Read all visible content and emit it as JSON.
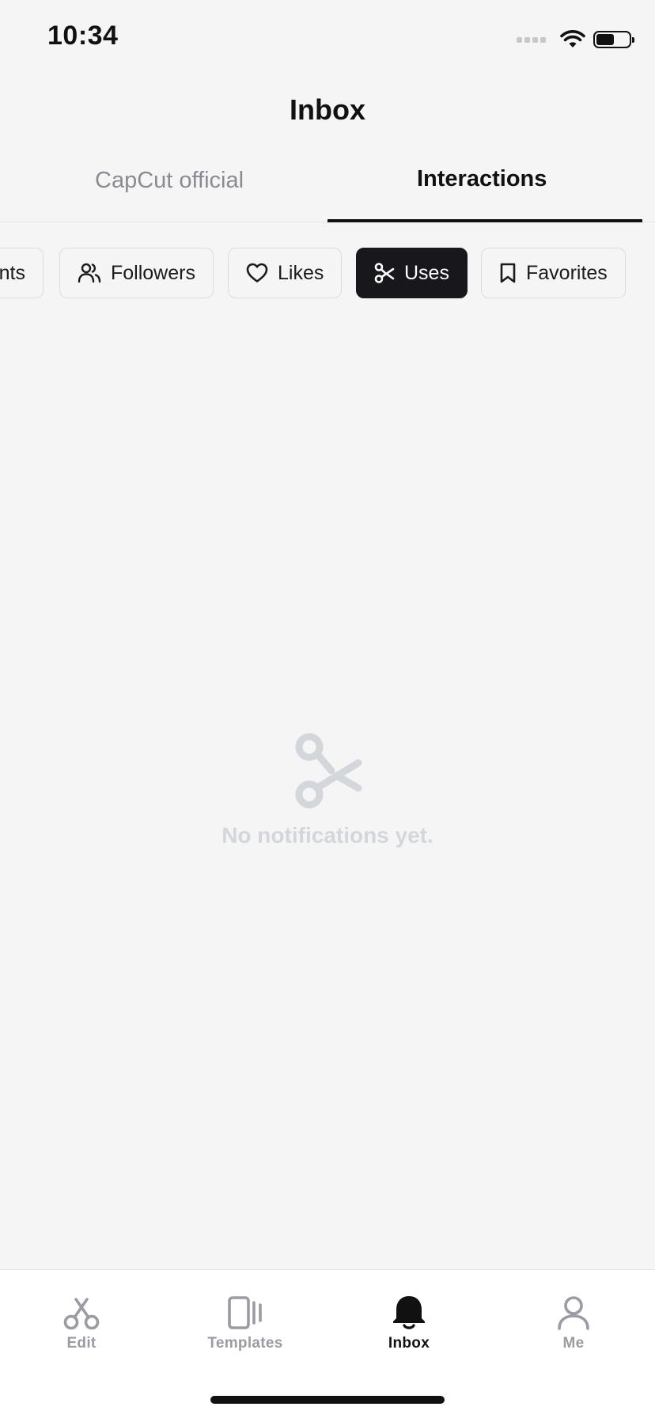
{
  "status_bar": {
    "time": "10:34"
  },
  "header": {
    "title": "Inbox"
  },
  "top_tabs": [
    {
      "label": "CapCut official",
      "active": false
    },
    {
      "label": "Interactions",
      "active": true
    }
  ],
  "filter_chips": [
    {
      "label": "nts",
      "icon": "comment-icon",
      "selected": false
    },
    {
      "label": "Followers",
      "icon": "followers-icon",
      "selected": false
    },
    {
      "label": "Likes",
      "icon": "heart-icon",
      "selected": false
    },
    {
      "label": "Uses",
      "icon": "scissors-icon",
      "selected": true
    },
    {
      "label": "Favorites",
      "icon": "bookmark-icon",
      "selected": false
    }
  ],
  "empty_state": {
    "icon": "scissors-icon",
    "message": "No notifications yet."
  },
  "bottom_nav": [
    {
      "label": "Edit",
      "icon": "scissors-icon",
      "active": false
    },
    {
      "label": "Templates",
      "icon": "templates-icon",
      "active": false
    },
    {
      "label": "Inbox",
      "icon": "bell-icon",
      "active": true
    },
    {
      "label": "Me",
      "icon": "person-icon",
      "active": false
    }
  ],
  "colors": {
    "background": "#f5f5f5",
    "selected_chip": "#17171c",
    "inactive_text": "#8a8a93",
    "empty_state": "#d3d6db"
  }
}
